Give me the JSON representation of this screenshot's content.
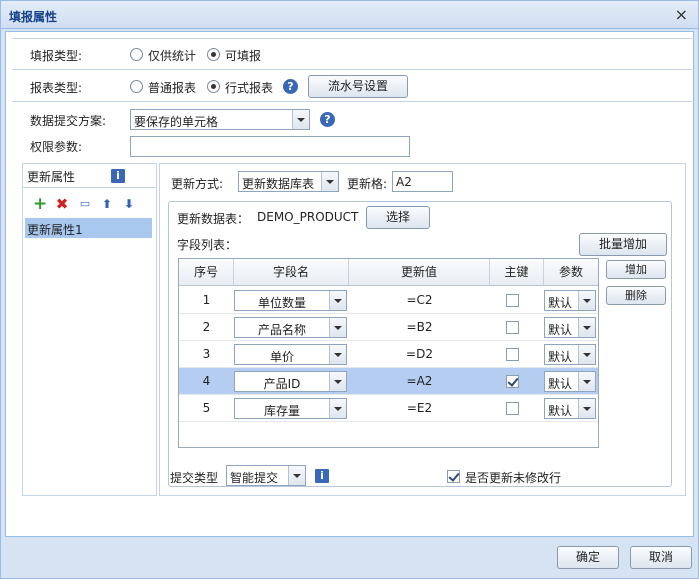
{
  "dialog": {
    "title": "填报属性",
    "close_glyph": "×"
  },
  "fill_type": {
    "label": "填报类型:",
    "options": [
      "仅供统计",
      "可填报"
    ],
    "selected": "可填报"
  },
  "report_type": {
    "label": "报表类型:",
    "options": [
      "普通报表",
      "行式报表"
    ],
    "selected": "行式报表",
    "serial_button": "流水号设置"
  },
  "submit_scheme": {
    "label": "数据提交方案:",
    "value": "要保存的单元格"
  },
  "permission": {
    "label": "权限参数:",
    "value": ""
  },
  "left_panel": {
    "title": "更新属性",
    "toolbar": [
      "add-icon",
      "delete-icon",
      "rename-icon",
      "move-up-icon",
      "move-down-icon"
    ],
    "items": [
      "更新属性1"
    ]
  },
  "update": {
    "method_label": "更新方式:",
    "method_value": "更新数据库表",
    "cell_label": "更新格:",
    "cell_value": "A2",
    "table_label": "更新数据表：",
    "table_value": "DEMO_PRODUCT",
    "select_button": "选择",
    "field_list_label": "字段列表：",
    "batch_add_button": "批量增加",
    "add_button": "增加",
    "delete_button": "删除"
  },
  "grid": {
    "headers": [
      "序号",
      "字段名",
      "更新值",
      "主键",
      "参数"
    ],
    "rows": [
      {
        "no": "1",
        "field": "单位数量",
        "value": "=C2",
        "key": false,
        "param": "默认",
        "selected": false
      },
      {
        "no": "2",
        "field": "产品名称",
        "value": "=B2",
        "key": false,
        "param": "默认",
        "selected": false
      },
      {
        "no": "3",
        "field": "单价",
        "value": "=D2",
        "key": false,
        "param": "默认",
        "selected": false
      },
      {
        "no": "4",
        "field": "产品ID",
        "value": "=A2",
        "key": true,
        "param": "默认",
        "selected": true
      },
      {
        "no": "5",
        "field": "库存量",
        "value": "=E2",
        "key": false,
        "param": "默认",
        "selected": false
      }
    ]
  },
  "submit_type": {
    "label": "提交类型",
    "value": "智能提交",
    "update_unmodified_label": "是否更新未修改行",
    "update_unmodified_checked": true
  },
  "footer": {
    "ok": "确定",
    "cancel": "取消"
  },
  "colors": {
    "accent": "#15428b",
    "selection": "#b4cdf0",
    "border": "#99bbe8"
  }
}
